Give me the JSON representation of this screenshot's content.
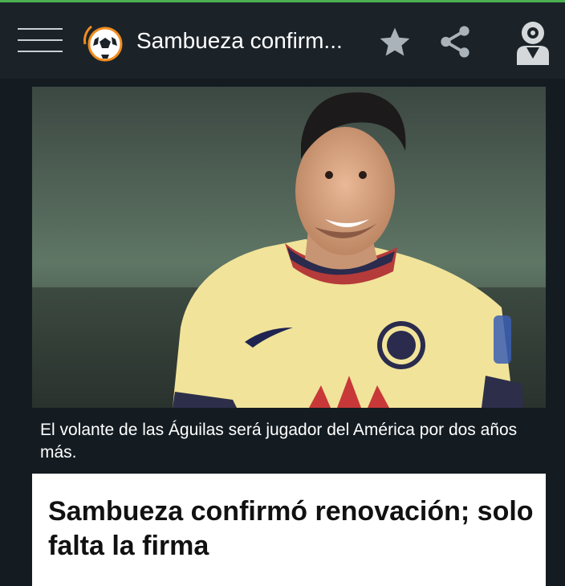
{
  "appbar": {
    "title": "Sambueza confirm...",
    "icons": [
      "menu-icon",
      "soccer-ball-logo",
      "star-icon",
      "share-icon",
      "profile-icon"
    ]
  },
  "article": {
    "image_caption": "El volante de las Águilas será jugador del América por dos años más.",
    "headline": "Sambueza confirmó renovación; solo falta la firma"
  },
  "colors": {
    "status_line": "#4caf50",
    "appbar_bg": "#1b2329",
    "page_bg": "#141c22",
    "logo_accent": "#f28c1e",
    "jersey": "#f1e39a"
  }
}
